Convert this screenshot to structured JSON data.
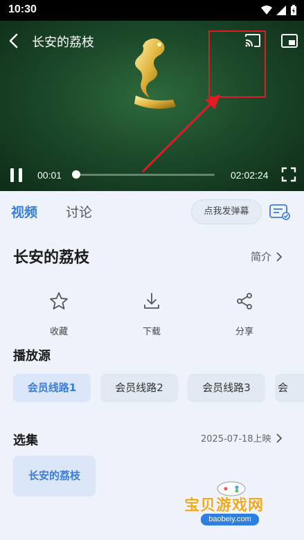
{
  "status_bar": {
    "time": "10:30"
  },
  "player": {
    "title": "长安的荔枝",
    "current_time": "00:01",
    "total_time": "02:02:24",
    "progress": 0.0
  },
  "tabs": {
    "video": "视频",
    "discussion": "讨论"
  },
  "danmaku_button": "点我发弹幕",
  "info": {
    "title": "长安的荔枝",
    "intro_label": "简介"
  },
  "actions": {
    "favorite": "收藏",
    "download": "下载",
    "share": "分享"
  },
  "sources": {
    "title": "播放源",
    "items": [
      "会员线路1",
      "会员线路2",
      "会员线路3",
      "会"
    ]
  },
  "episodes": {
    "title": "选集",
    "release_date": "2025-07-18上映",
    "items": [
      "长安的荔枝"
    ]
  },
  "watermark": {
    "text": "宝贝游戏网",
    "url": "baobeiy.com"
  },
  "colors": {
    "accent": "#3a7ce0",
    "annotation": "#e21a24"
  }
}
